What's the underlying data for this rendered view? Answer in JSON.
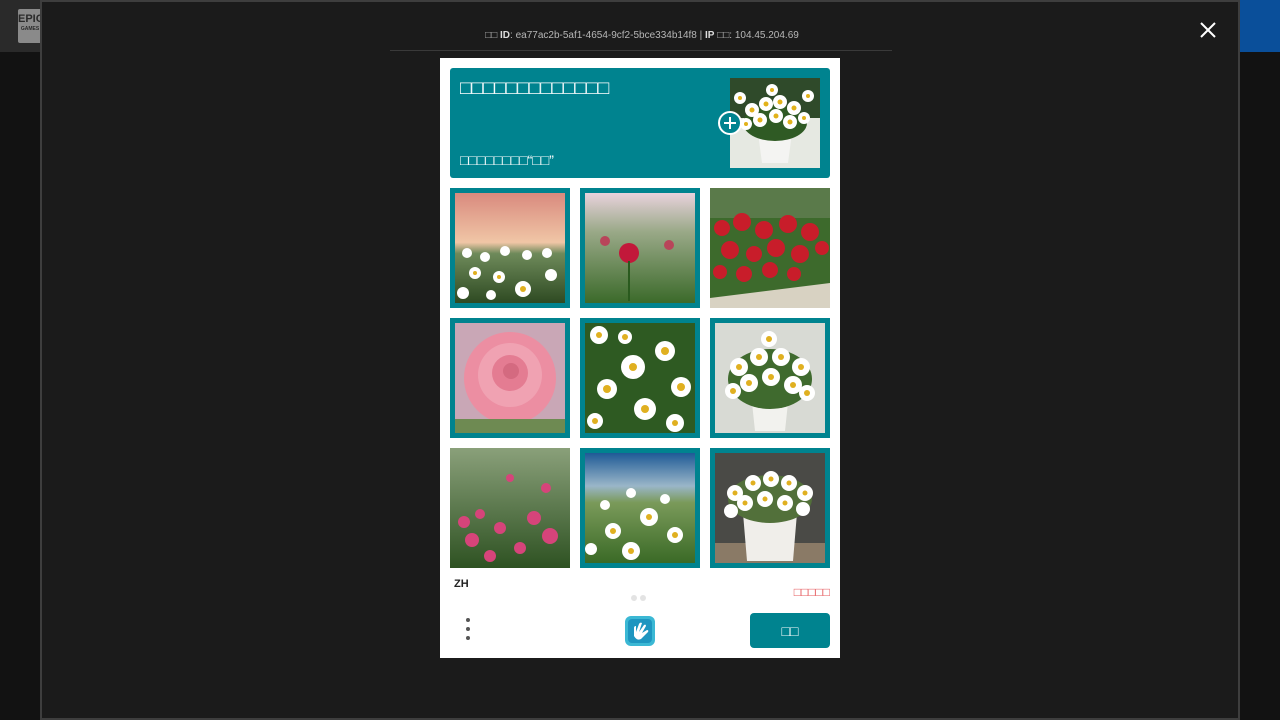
{
  "background": {
    "logo_text": "EPIC",
    "logo_sub": "GAMES"
  },
  "modal": {
    "id_prefix": "□□ ",
    "id_label": "ID",
    "id_value": ": ea77ac2b-5af1-4654-9cf2-5bce334b14f8 | ",
    "ip_label": "IP",
    "ip_value": " □□: 104.45.204.69"
  },
  "captcha": {
    "prompt_title": "□□□□□□□□□□□□□",
    "prompt_sub": "□□□□□□□□“□□”",
    "language": "ZH",
    "report_label": "□□□□□",
    "verify_label": "□□",
    "tiles": [
      {
        "name": "tile-daisy-field-sunset",
        "selected": true
      },
      {
        "name": "tile-red-rose-field",
        "selected": true
      },
      {
        "name": "tile-red-flowers-garden",
        "selected": false
      },
      {
        "name": "tile-pink-rose",
        "selected": true
      },
      {
        "name": "tile-daisy-closeup",
        "selected": true
      },
      {
        "name": "tile-daisy-pot",
        "selected": true
      },
      {
        "name": "tile-pink-flowers-field",
        "selected": false
      },
      {
        "name": "tile-daisy-sky",
        "selected": true
      },
      {
        "name": "tile-daisy-white-pot",
        "selected": true
      }
    ]
  },
  "colors": {
    "accent": "#00838f",
    "report": "#e5575a"
  }
}
